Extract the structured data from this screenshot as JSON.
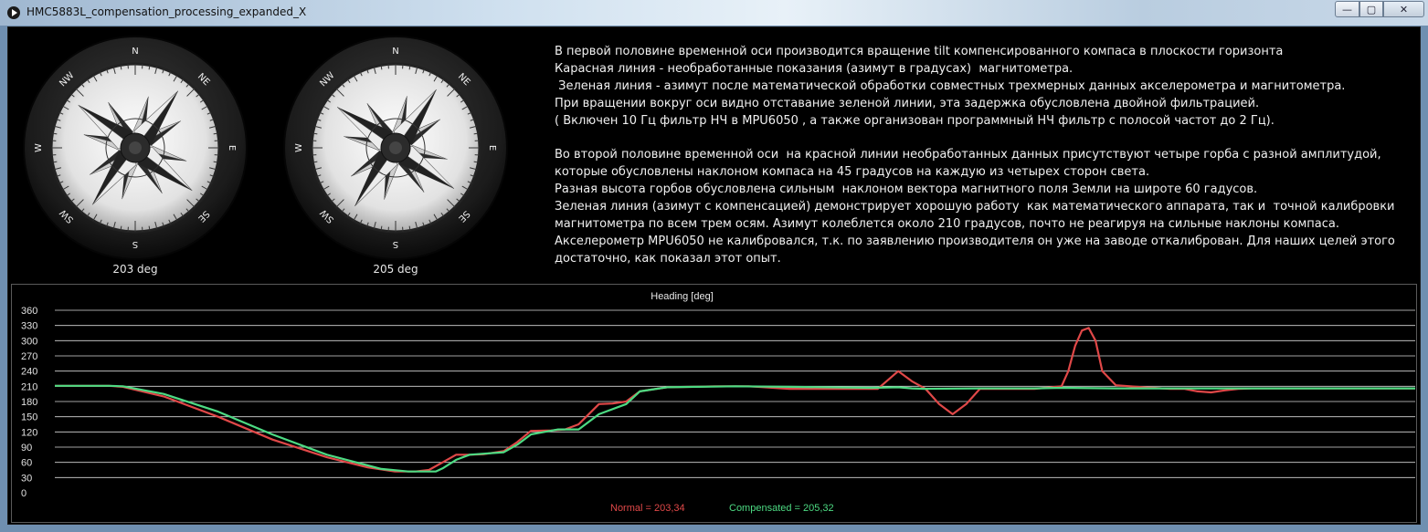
{
  "window": {
    "title": "HMC5883L_compensation_processing_expanded_X",
    "buttons": {
      "minimize": "—",
      "maximize": "▢",
      "close": "✕"
    }
  },
  "compasses": [
    {
      "readout": "203 deg",
      "cardinals": [
        "N",
        "NE",
        "E",
        "SE",
        "S",
        "SW",
        "W",
        "NW"
      ],
      "heading_deg": 203
    },
    {
      "readout": "205 deg",
      "cardinals": [
        "N",
        "NE",
        "E",
        "SE",
        "S",
        "SW",
        "W",
        "NW"
      ],
      "heading_deg": 205
    }
  ],
  "description": {
    "lines": [
      "В первой половине временной оси производится вращение tilt компенсированного компаса в плоскости горизонта",
      "Карасная линия - необработанные показания (азимут в градусах)  магнитометра.",
      " Зеленая линия - азимут после математической обработки совместных трехмерных данных акселерометра и магнитометра.",
      "При вращении вокруг оси видно отставание зеленой линии, эта задержка обусловлена двойной фильтрацией.",
      "( Включен 10 Гц фильтр НЧ в MPU6050 , а также организован программный НЧ фильтр с полосой частот до 2 Гц).",
      "",
      "Во второй половине временной оси  на красной линии необработанных данных присутствуют четыре горба с разной амплитудой,",
      "которые обусловлены наклоном компаса на 45 градусов на каждую из четырех сторон света.",
      "Разная высота горбов обусловлена сильным  наклоном вектора магнитного поля Земли на широте 60 гадусов.",
      "Зеленая линия (азимут с компенсацией) демонстрирует хорошую работу  как математического аппарата, так и  точной калибровки",
      "магнитометра по всем трем осям. Азимут колеблется около 210 градусов, почто не реагируя на сильные наклоны компаса.",
      "Акселерометр MPU6050 не калибровался, т.к. по заявлению производителя он уже на заводе откалиброван. Для наших целей этого",
      "достаточно, как показал этот опыт."
    ]
  },
  "chart_data": {
    "type": "line",
    "title": "Heading [deg]",
    "ylim": [
      0,
      360
    ],
    "yticks": [
      0,
      30,
      60,
      90,
      120,
      150,
      180,
      210,
      240,
      270,
      300,
      330,
      360
    ],
    "ytick_labels": [
      "0",
      "30",
      "60",
      "90",
      "120",
      "150",
      "180",
      "210",
      "240",
      "270",
      "300",
      "330",
      "360"
    ],
    "grid": true,
    "xlim": [
      0,
      100
    ],
    "series": [
      {
        "name": "Normal = 203,34",
        "color": "#e04848",
        "x": [
          0,
          4,
          5,
          8,
          12,
          16,
          20,
          23,
          25,
          26.5,
          27.5,
          28.5,
          29.5,
          30.5,
          31.5,
          33,
          34,
          35,
          36.5,
          37.5,
          38.5,
          40,
          41,
          42,
          43,
          45,
          47,
          48.5,
          50,
          51,
          54,
          57,
          59,
          60.5,
          62,
          63,
          64,
          65,
          66,
          67,
          68,
          69,
          70,
          72,
          74,
          74.5,
          75,
          75.5,
          76,
          76.5,
          77,
          78,
          80,
          82,
          83,
          84,
          85,
          86,
          87,
          88,
          100
        ],
        "y": [
          211,
          211,
          209,
          190,
          150,
          105,
          70,
          50,
          42,
          42,
          45,
          60,
          75,
          75,
          76,
          82,
          100,
          122,
          123,
          125,
          135,
          175,
          176,
          180,
          200,
          208,
          209,
          210,
          210,
          210,
          205,
          205,
          205,
          205,
          240,
          220,
          205,
          175,
          155,
          175,
          205,
          205,
          205,
          205,
          210,
          240,
          290,
          320,
          325,
          300,
          240,
          212,
          208,
          205,
          205,
          200,
          198,
          202,
          205,
          206,
          206
        ]
      },
      {
        "name": "Compensated = 205,32",
        "color": "#4ddb83",
        "x": [
          0,
          4,
          5,
          8,
          12,
          16,
          20,
          24,
          26,
          28,
          28.5,
          29.5,
          30.5,
          33,
          34,
          35,
          37,
          38.5,
          40,
          42,
          43,
          45,
          47,
          50,
          54,
          60,
          62,
          63,
          64,
          68,
          72,
          74,
          78,
          84,
          88,
          100
        ],
        "y": [
          211,
          211,
          210,
          195,
          160,
          115,
          75,
          47,
          42,
          42,
          48,
          65,
          75,
          80,
          95,
          115,
          125,
          125,
          155,
          175,
          200,
          208,
          209,
          210,
          209,
          207,
          208,
          206,
          205,
          206,
          206,
          207,
          206,
          206,
          206,
          206
        ]
      }
    ]
  }
}
